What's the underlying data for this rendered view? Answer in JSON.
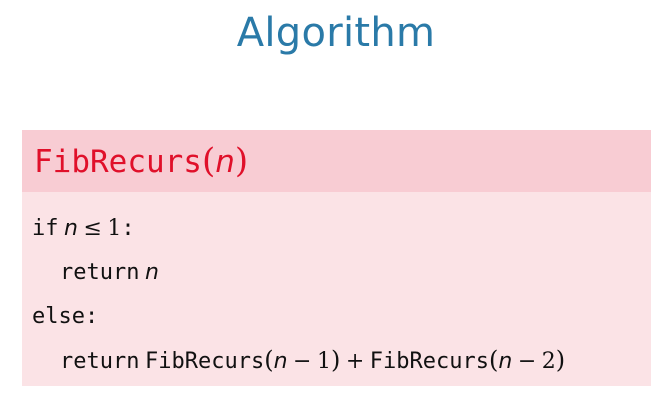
{
  "slide": {
    "title": "Algorithm"
  },
  "block": {
    "name": "FibRecurs",
    "param": "n"
  },
  "code": {
    "line1": {
      "kw": "if",
      "var": "n",
      "op": "≤",
      "num": "1",
      "colon": ":"
    },
    "line2": {
      "kw": "return",
      "var": "n"
    },
    "line3": {
      "kw": "else:"
    },
    "line4": {
      "kw": "return",
      "fn1": "FibRecurs",
      "var1": "n",
      "minus1": "−",
      "num1": "1",
      "plus": "+",
      "fn2": "FibRecurs",
      "var2": "n",
      "minus2": "−",
      "num2": "2"
    }
  }
}
